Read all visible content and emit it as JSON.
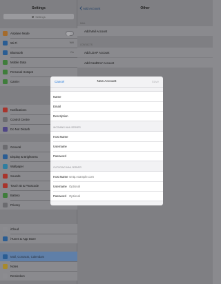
{
  "status_bar": {
    "time": "10:40"
  },
  "sidebar": {
    "title": "Settings",
    "search_placeholder": "Settings",
    "groups": [
      {
        "items": [
          {
            "label": "Airplane Mode",
            "icon": "airplane-icon",
            "color": "#a46b2c",
            "toggle": true
          },
          {
            "label": "Wi-Fi",
            "icon": "wifi-icon",
            "color": "#2a5d93",
            "value": "Wifi"
          },
          {
            "label": "Bluetooth",
            "icon": "bluetooth-icon",
            "color": "#2a5d93",
            "value": "On"
          },
          {
            "label": "Mobile Data",
            "icon": "mobile-data-icon",
            "color": "#3f7d3b"
          },
          {
            "label": "Personal Hotspot",
            "icon": "hotspot-icon",
            "color": "#3f7d3b"
          },
          {
            "label": "Carrier",
            "icon": "carrier-icon",
            "color": "#3f7d3b"
          }
        ]
      },
      {
        "items": [
          {
            "label": "Notifications",
            "icon": "notifications-icon",
            "color": "#a8342c"
          },
          {
            "label": "Control Centre",
            "icon": "control-centre-icon",
            "color": "#6b6b6f"
          },
          {
            "label": "Do Not Disturb",
            "icon": "moon-icon",
            "color": "#4f4686"
          }
        ]
      },
      {
        "items": [
          {
            "label": "General",
            "icon": "gear-icon",
            "color": "#6b6b6f"
          },
          {
            "label": "Display & Brightness",
            "icon": "brightness-icon",
            "color": "#2a5d93"
          },
          {
            "label": "Wallpaper",
            "icon": "wallpaper-icon",
            "color": "#2f7ea0"
          },
          {
            "label": "Sounds",
            "icon": "sounds-icon",
            "color": "#a8342c"
          },
          {
            "label": "Touch ID & Passcode",
            "icon": "fingerprint-icon",
            "color": "#a8342c"
          },
          {
            "label": "Battery",
            "icon": "battery-icon",
            "color": "#3f7d3b"
          },
          {
            "label": "Privacy",
            "icon": "privacy-icon",
            "color": "#6b6b6f"
          }
        ]
      },
      {
        "items": [
          {
            "label": "iCloud",
            "icon": "cloud-icon",
            "color": "#8c8c90",
            "value": ""
          },
          {
            "label": "iTunes & App Store",
            "icon": "app-store-icon",
            "color": "#2a5d93"
          }
        ]
      },
      {
        "items": [
          {
            "label": "Mail, Contacts, Calendars",
            "icon": "mail-icon",
            "color": "#2a5d93",
            "selected": true
          },
          {
            "label": "Notes",
            "icon": "notes-icon",
            "color": "#a88a2c"
          },
          {
            "label": "Reminders",
            "icon": "reminders-icon",
            "color": "#8c8c90"
          }
        ]
      }
    ]
  },
  "detail": {
    "back_label": "Add Account",
    "title": "Other",
    "sections": [
      {
        "header": "Mail",
        "cells": [
          "Add Mail Account"
        ]
      },
      {
        "header": "Contacts",
        "cells": [
          "Add LDAP Account",
          "Add CardDAV Account"
        ]
      }
    ]
  },
  "modal": {
    "cancel_label": "Cancel",
    "title": "New Account",
    "save_label": "Save",
    "account_fields": [
      {
        "label": "Name",
        "placeholder": ""
      },
      {
        "label": "Email",
        "placeholder": ""
      },
      {
        "label": "Description",
        "placeholder": ""
      }
    ],
    "incoming_header": "Incoming Mail Server",
    "incoming_fields": [
      {
        "label": "Host Name",
        "placeholder": ""
      },
      {
        "label": "Username",
        "placeholder": ""
      },
      {
        "label": "Password",
        "placeholder": ""
      }
    ],
    "outgoing_header": "Outgoing Mail Server",
    "outgoing_fields": [
      {
        "label": "Host Name",
        "placeholder": "smtp.example.com"
      },
      {
        "label": "Username",
        "placeholder": "Optional"
      },
      {
        "label": "Password",
        "placeholder": "Optional"
      }
    ]
  }
}
